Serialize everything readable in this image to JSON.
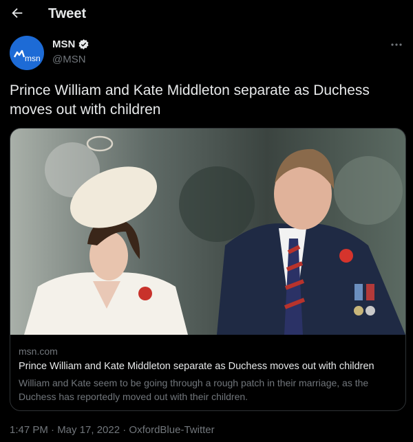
{
  "header": {
    "title": "Tweet",
    "back_icon": "arrow-left-icon"
  },
  "author": {
    "display_name": "MSN",
    "handle": "@MSN",
    "avatar_text": "msn",
    "verified_icon": "verified-badge-icon",
    "more_icon": "more-horizontal-icon"
  },
  "tweet": {
    "text": "Prince William and Kate Middleton separate as Duchess moves out with children"
  },
  "card": {
    "domain": "msn.com",
    "title": "Prince William and Kate Middleton separate as Duchess moves out with children",
    "description": "William and Kate seem to be going through a rough patch in their marriage, as the Duchess has reportedly moved out with their children."
  },
  "meta": {
    "time": "1:47 PM",
    "date": "May 17, 2022",
    "source": "OxfordBlue-Twitter",
    "line": "1:47 PM · May 17, 2022 · OxfordBlue-Twitter"
  },
  "colors": {
    "background": "#000000",
    "text_primary": "#e7e9ea",
    "text_secondary": "#71767b",
    "border": "#2f3336",
    "avatar_bg": "#1d6bd6"
  }
}
